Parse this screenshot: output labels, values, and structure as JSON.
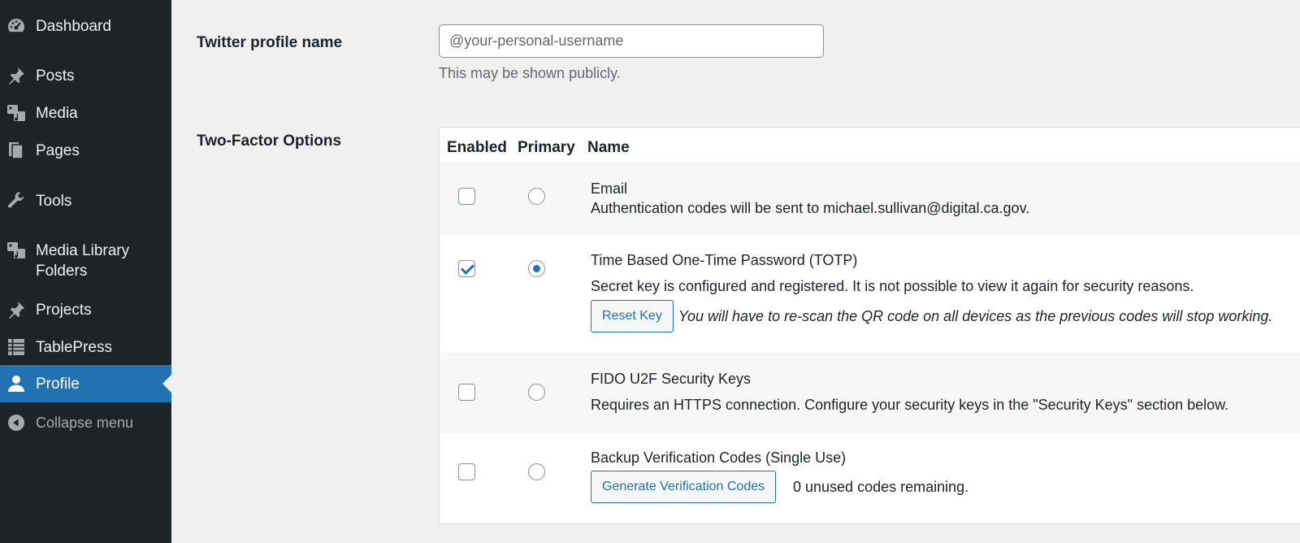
{
  "sidebar": {
    "items": [
      {
        "label": "Dashboard",
        "icon": "dashboard-icon"
      },
      {
        "label": "Posts",
        "icon": "pin-icon"
      },
      {
        "label": "Media",
        "icon": "media-icon"
      },
      {
        "label": "Pages",
        "icon": "pages-icon"
      },
      {
        "label": "Tools",
        "icon": "wrench-icon"
      },
      {
        "label_line1": "Media Library",
        "label_line2": "Folders",
        "icon": "media-icon"
      },
      {
        "label": "Projects",
        "icon": "pin-icon"
      },
      {
        "label": "TablePress",
        "icon": "table-icon"
      },
      {
        "label": "Profile",
        "icon": "user-icon",
        "current": true
      }
    ],
    "collapse_label": "Collapse menu",
    "colors": {
      "background": "#1d2327",
      "current": "#2271b1"
    }
  },
  "twitter": {
    "label": "Twitter profile name",
    "placeholder": "@your-personal-username",
    "description": "This may be shown publicly."
  },
  "two_factor": {
    "label": "Two-Factor Options",
    "headers": {
      "enabled": "Enabled",
      "primary": "Primary",
      "name": "Name"
    },
    "options": [
      {
        "name": "Email",
        "description": "Authentication codes will be sent to michael.sullivan@digital.ca.gov.",
        "enabled": false,
        "primary": false
      },
      {
        "name": "Time Based One-Time Password (TOTP)",
        "description": "Secret key is configured and registered. It is not possible to view it again for security reasons.",
        "button": "Reset Key",
        "note": "You will have to re-scan the QR code on all devices as the previous codes will stop working.",
        "enabled": true,
        "primary": true
      },
      {
        "name": "FIDO U2F Security Keys",
        "description": "Requires an HTTPS connection. Configure your security keys in the \"Security Keys\" section below.",
        "enabled": false,
        "primary": false
      },
      {
        "name": "Backup Verification Codes (Single Use)",
        "button": "Generate Verification Codes",
        "note": "0 unused codes remaining.",
        "enabled": false,
        "primary": false
      }
    ]
  }
}
